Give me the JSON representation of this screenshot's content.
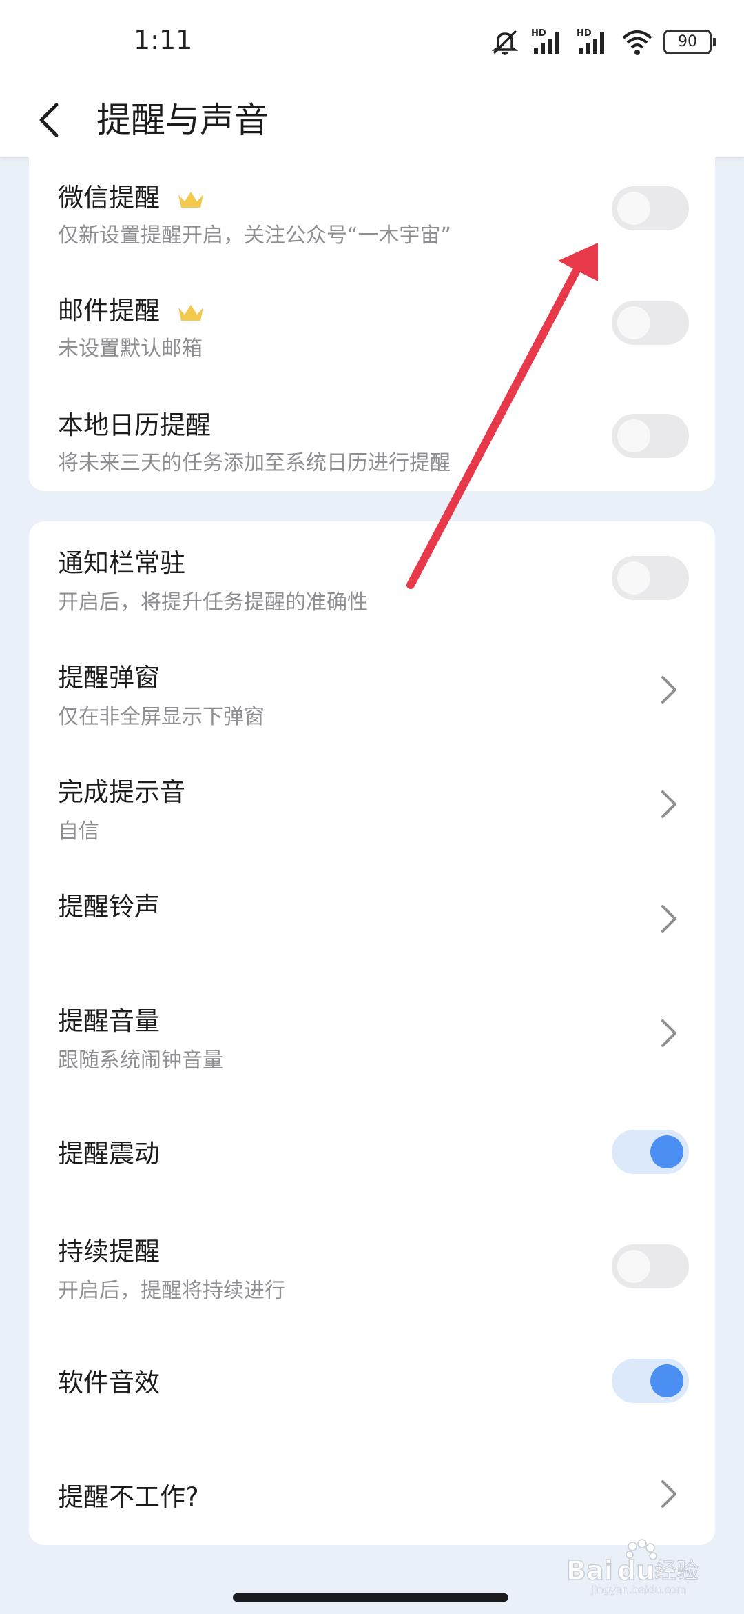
{
  "status_bar": {
    "time": "1:11",
    "battery_level": "90",
    "icons": [
      "mute-icon",
      "hd-signal-icon",
      "hd-signal-icon",
      "wifi-icon",
      "battery-icon"
    ]
  },
  "header": {
    "title": "提醒与声音"
  },
  "section1": {
    "items": [
      {
        "title": "微信提醒",
        "subtitle": "仅新设置提醒开启，关注公众号“一木宇宙”",
        "premium": true,
        "toggle": false
      },
      {
        "title": "邮件提醒",
        "subtitle": "未设置默认邮箱",
        "premium": true,
        "toggle": false
      },
      {
        "title": "本地日历提醒",
        "subtitle": "将未来三天的任务添加至系统日历进行提醒",
        "premium": false,
        "toggle": false
      }
    ]
  },
  "section2": {
    "items": [
      {
        "title": "通知栏常驻",
        "subtitle": "开启后，将提升任务提醒的准确性",
        "control": "toggle",
        "toggle": false
      },
      {
        "title": "提醒弹窗",
        "subtitle": "仅在非全屏显示下弹窗",
        "control": "chevron"
      },
      {
        "title": "完成提示音",
        "subtitle": "自信",
        "control": "chevron"
      },
      {
        "title": "提醒铃声",
        "subtitle": "",
        "control": "chevron"
      },
      {
        "title": "提醒音量",
        "subtitle": "跟随系统闹钟音量",
        "control": "chevron"
      },
      {
        "title": "提醒震动",
        "subtitle": "",
        "control": "toggle",
        "toggle": true
      },
      {
        "title": "持续提醒",
        "subtitle": "开启后，提醒将持续进行",
        "control": "toggle",
        "toggle": false
      },
      {
        "title": "软件音效",
        "subtitle": "",
        "control": "toggle",
        "toggle": true
      },
      {
        "title": "提醒不工作?",
        "subtitle": "",
        "control": "chevron"
      }
    ]
  },
  "colors": {
    "accent": "#4b8ff2",
    "annotation_arrow": "#e8394a",
    "background": "#eaf0f7",
    "crown": "#f2c94c"
  },
  "watermark": {
    "brand": "Bai",
    "brand_suffix": "du",
    "label": "经验",
    "url": "jingyan.baidu.com"
  }
}
